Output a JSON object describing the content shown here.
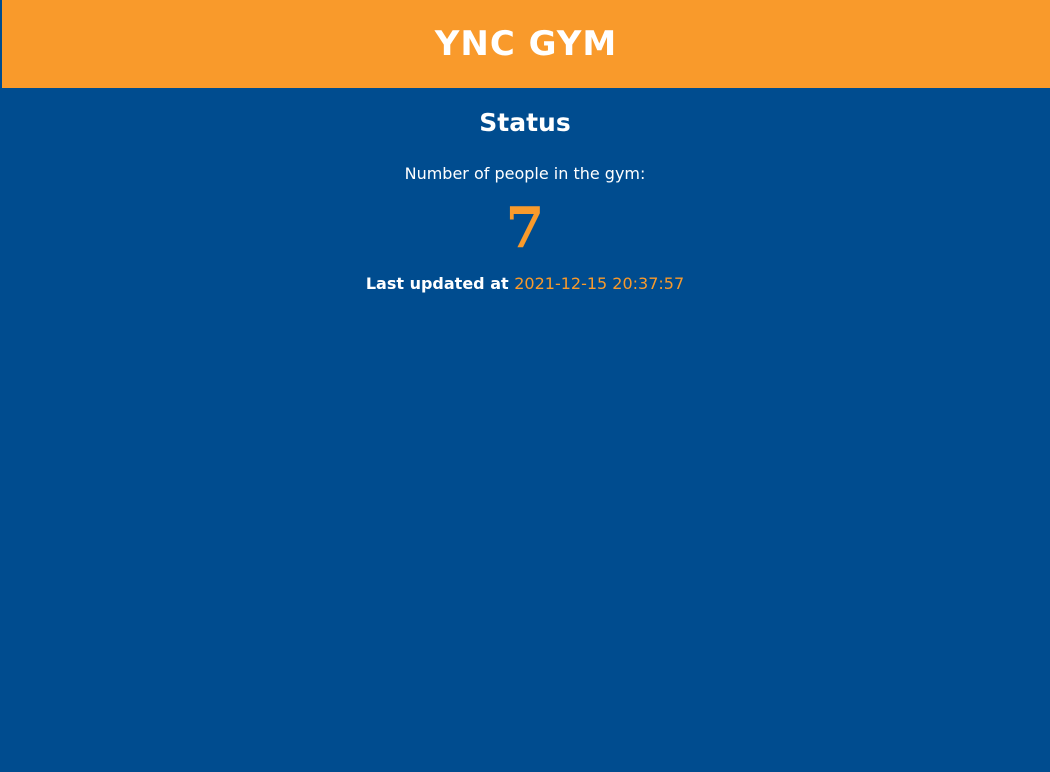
{
  "header": {
    "title": "YNC GYM"
  },
  "main": {
    "heading": "Status",
    "people_label": "Number of people in the gym:",
    "people_count": "7",
    "last_updated_label": "Last updated at",
    "last_updated_value": "2021-12-15 20:37:57"
  },
  "colors": {
    "header_background": "#f99a2b",
    "page_background": "#004c8f",
    "accent": "#f99a2b",
    "text": "#ffffff"
  }
}
